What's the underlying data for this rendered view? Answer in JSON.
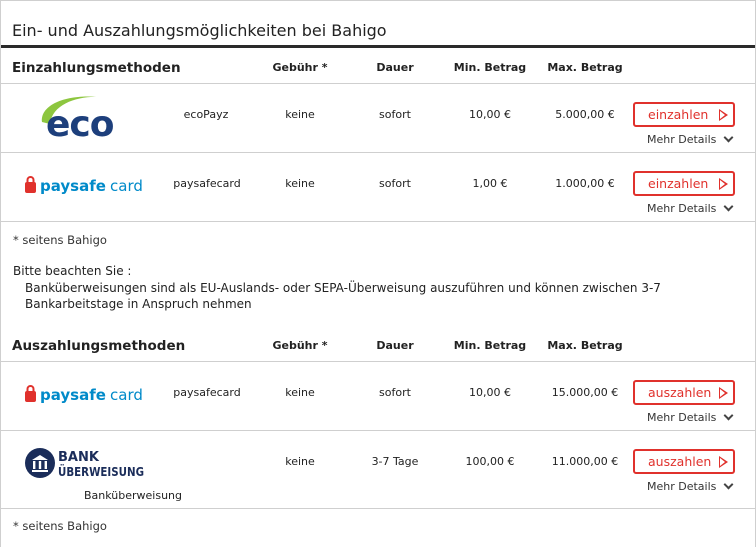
{
  "title": "Ein- und Auszahlungsmöglichkeiten bei Bahigo",
  "columns": {
    "fee": "Gebühr *",
    "duration": "Dauer",
    "min": "Min. Betrag",
    "max": "Max. Betrag"
  },
  "deposit": {
    "heading": "Einzahlungsmethoden",
    "rows": [
      {
        "logo": "ecoPayz-logo",
        "name": "ecoPayz",
        "fee": "keine",
        "duration": "sofort",
        "min": "10,00 €",
        "max": "5.000,00 €",
        "button": "einzahlen",
        "details": "Mehr Details"
      },
      {
        "logo": "paysafecard-logo",
        "name": "paysafecard",
        "fee": "keine",
        "duration": "sofort",
        "min": "1,00 €",
        "max": "1.000,00 €",
        "button": "einzahlen",
        "details": "Mehr Details"
      }
    ],
    "footnote": "* seitens Bahigo"
  },
  "notice": {
    "heading": "Bitte beachten Sie :",
    "text": "Banküberweisungen sind als EU-Auslands- oder SEPA-Überweisung auszuführen und können zwischen 3-7 Bankarbeitstage in Anspruch nehmen"
  },
  "withdrawal": {
    "heading": "Auszahlungsmethoden",
    "rows": [
      {
        "logo": "paysafecard-logo",
        "name": "paysafecard",
        "fee": "keine",
        "duration": "sofort",
        "min": "10,00 €",
        "max": "15.000,00 €",
        "button": "auszahlen",
        "details": "Mehr Details"
      },
      {
        "logo": "bank-transfer-logo",
        "name": "Banküberweisung",
        "fee": "keine",
        "duration": "3-7 Tage",
        "min": "100,00 €",
        "max": "11.000,00 €",
        "button": "auszahlen",
        "details": "Mehr Details"
      }
    ],
    "footnote": "* seitens Bahigo"
  },
  "logos": {
    "eco_text": "eco",
    "paysafe_a": "paysafe",
    "paysafe_b": "card",
    "bank_line1": "BANK",
    "bank_line2": "ÜBERWEISUNG"
  },
  "colors": {
    "accent": "#e0312c",
    "eco_blue": "#1d3f7c",
    "eco_green": "#8dc63f",
    "paysafe_blue": "#008ac9",
    "bank_navy": "#1b2d5a"
  }
}
